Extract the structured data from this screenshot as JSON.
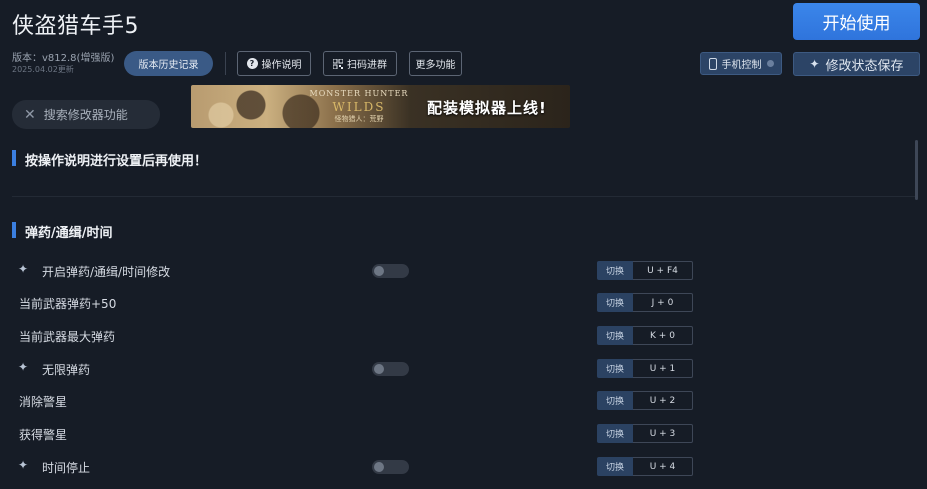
{
  "app": {
    "title": "侠盗猎车手5",
    "start_label": "开始使用"
  },
  "version": {
    "line": "版本：v812.8(增强版)",
    "date": "2025.04.02更新"
  },
  "toolbar": {
    "history_label": "版本历史记录",
    "guide_label": "操作说明",
    "scan_label": "扫码进群",
    "more_label": "更多功能",
    "phone_label": "手机控制",
    "save_label": "修改状态保存"
  },
  "search": {
    "placeholder": "搜索修改器功能"
  },
  "banner": {
    "game_title": "MONSTER HUNTER",
    "game_subtitle": "WILDS",
    "game_caption": "怪物猎人：荒野",
    "promo_text": "配装模拟器上线!"
  },
  "notice": {
    "text": "按操作说明进行设置后再使用！"
  },
  "section": {
    "title": "弹药/通缉/时间"
  },
  "rows": [
    {
      "label": "开启弹药/通缉/时间修改",
      "switch_label": "切换",
      "hotkey": "U + F4",
      "toggle_on": false
    },
    {
      "label": "当前武器弹药+50",
      "switch_label": "切换",
      "hotkey": "J + 0"
    },
    {
      "label": "当前武器最大弹药",
      "switch_label": "切换",
      "hotkey": "K + 0"
    },
    {
      "label": "无限弹药",
      "switch_label": "切换",
      "hotkey": "U + 1",
      "toggle_on": false
    },
    {
      "label": "消除警星",
      "switch_label": "切换",
      "hotkey": "U + 2"
    },
    {
      "label": "获得警星",
      "switch_label": "切换",
      "hotkey": "U + 3"
    },
    {
      "label": "时间停止",
      "switch_label": "切换",
      "hotkey": "U + 4",
      "toggle_on": false
    }
  ],
  "colors": {
    "accent": "#3b7fe0",
    "background": "#161c26"
  }
}
